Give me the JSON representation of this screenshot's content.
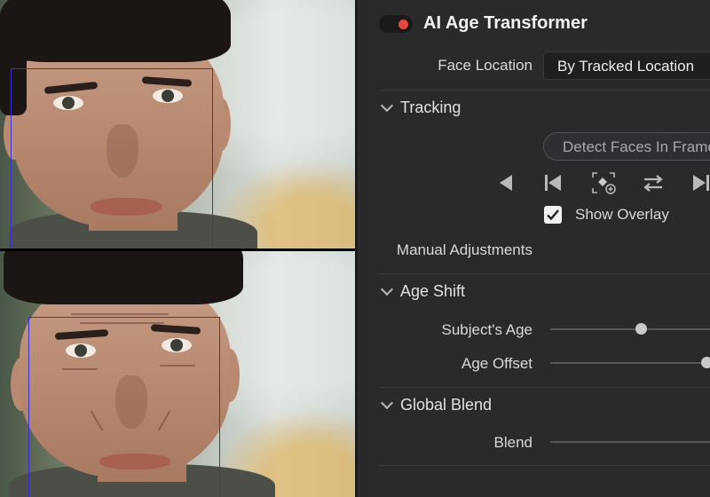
{
  "panel": {
    "effect_enabled": true,
    "effect_title": "AI Age Transformer",
    "face_location": {
      "label": "Face Location",
      "value": "By Tracked Location"
    },
    "tracking": {
      "label": "Tracking",
      "detect_button": "Detect Faces In Frame",
      "toolbar_icons": [
        "step-back-icon",
        "go-to-start-icon",
        "add-face-icon",
        "swap-direction-icon",
        "play-forward-icon"
      ],
      "show_overlay": {
        "label": "Show Overlay",
        "checked": true
      }
    },
    "manual_adjustments_label": "Manual Adjustments",
    "age_shift": {
      "label": "Age Shift",
      "subjects_age": {
        "label": "Subject's Age",
        "value": 0.32
      },
      "age_offset": {
        "label": "Age Offset",
        "value": 0.55
      }
    },
    "global_blend": {
      "label": "Global Blend",
      "blend": {
        "label": "Blend",
        "value": 1.0
      }
    }
  },
  "viewer": {
    "overlay_color": "#3a2fd1",
    "frames": [
      "original",
      "aged"
    ]
  },
  "colors": {
    "panel_bg": "#2a2a2d",
    "toggle_red": "#e8473d"
  }
}
